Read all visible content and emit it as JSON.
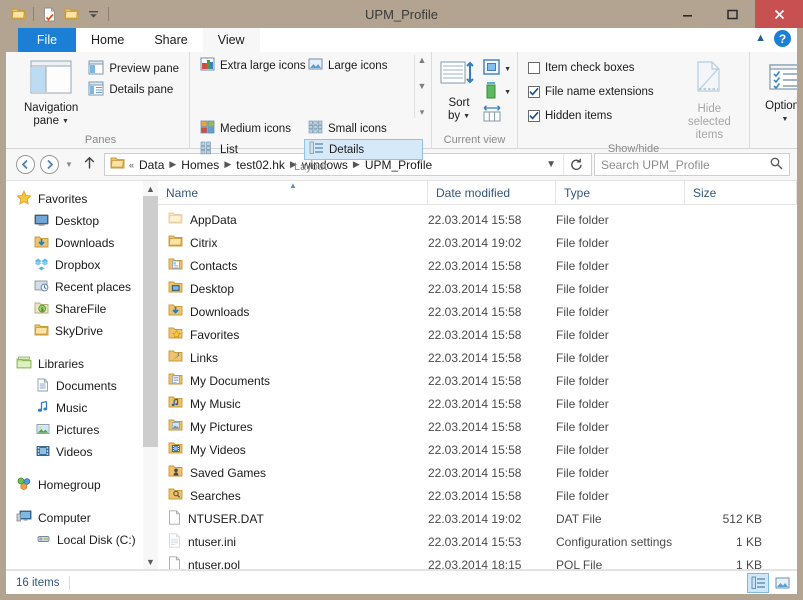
{
  "window": {
    "title": "UPM_Profile",
    "quick_access": [
      {
        "name": "folder-icon",
        "label": "Folder"
      },
      {
        "name": "properties-icon",
        "label": "Properties"
      },
      {
        "name": "new-folder-icon",
        "label": "New folder"
      },
      {
        "name": "customize-dropdown-icon",
        "label": "Customize Quick Access Toolbar"
      }
    ],
    "controls": {
      "minimize": "Minimize",
      "maximize": "Maximize",
      "close": "Close"
    },
    "accent_blue": "#1c7fd6",
    "titlebar_color": "#b3a391",
    "close_color": "#c75050"
  },
  "ribbon": {
    "tabs": [
      {
        "label": "File",
        "active": false,
        "kind": "file"
      },
      {
        "label": "Home",
        "active": false,
        "kind": "normal"
      },
      {
        "label": "Share",
        "active": false,
        "kind": "normal"
      },
      {
        "label": "View",
        "active": true,
        "kind": "normal"
      }
    ],
    "collapse_label": "Minimize the Ribbon",
    "help_label": "?",
    "groups": [
      {
        "name": "panes",
        "label": "Panes",
        "big_button": {
          "label_line1": "Navigation",
          "label_line2": "pane",
          "has_dropdown": true
        },
        "small_buttons": [
          {
            "label": "Preview pane",
            "selected": false
          },
          {
            "label": "Details pane",
            "selected": false
          }
        ]
      },
      {
        "name": "layout",
        "label": "Layout",
        "items": [
          {
            "label": "Extra large icons",
            "selected": false
          },
          {
            "label": "Large icons",
            "selected": false
          },
          {
            "label": "Medium icons",
            "selected": false
          },
          {
            "label": "Small icons",
            "selected": false
          },
          {
            "label": "List",
            "selected": false
          },
          {
            "label": "Details",
            "selected": true
          }
        ]
      },
      {
        "name": "current-view",
        "label": "Current view",
        "sort_by": {
          "label_line1": "Sort",
          "label_line2": "by",
          "has_dropdown": true
        },
        "buttons": [
          {
            "name": "add-columns-button",
            "label": "Add columns"
          },
          {
            "name": "size-all-columns-button",
            "label": "Size all columns to fit"
          }
        ]
      },
      {
        "name": "show-hide",
        "label": "Show/hide",
        "checkboxes": [
          {
            "label": "Item check boxes",
            "checked": false
          },
          {
            "label": "File name extensions",
            "checked": true
          },
          {
            "label": "Hidden items",
            "checked": true
          }
        ],
        "hide_selected": {
          "label_line1": "Hide selected",
          "label_line2": "items",
          "disabled": true
        }
      },
      {
        "name": "options",
        "label": "",
        "options_button": {
          "label": "Options",
          "has_dropdown": true
        }
      }
    ]
  },
  "address_bar": {
    "back_label": "Back",
    "forward_label": "Forward",
    "recent_label": "Recent locations",
    "up_label": "Up",
    "breadcrumbs": [
      "Data",
      "Homes",
      "test02.hk",
      "windows",
      "UPM_Profile"
    ],
    "overflow_marker": "«",
    "dropdown_label": "Previous locations",
    "refresh_label": "Refresh",
    "search": {
      "placeholder": "Search UPM_Profile",
      "value": "",
      "icon": "search-icon"
    }
  },
  "sidebar": {
    "sections": [
      {
        "name": "favorites",
        "label": "Favorites",
        "icon": "star-icon",
        "items": [
          {
            "label": "Desktop",
            "icon": "desktop-icon"
          },
          {
            "label": "Downloads",
            "icon": "downloads-icon"
          },
          {
            "label": "Dropbox",
            "icon": "dropbox-icon"
          },
          {
            "label": "Recent places",
            "icon": "recent-places-icon"
          },
          {
            "label": "ShareFile",
            "icon": "sharefile-icon"
          },
          {
            "label": "SkyDrive",
            "icon": "skydrive-icon"
          }
        ]
      },
      {
        "name": "libraries",
        "label": "Libraries",
        "icon": "libraries-icon",
        "items": [
          {
            "label": "Documents",
            "icon": "documents-icon"
          },
          {
            "label": "Music",
            "icon": "music-icon"
          },
          {
            "label": "Pictures",
            "icon": "pictures-icon"
          },
          {
            "label": "Videos",
            "icon": "videos-icon"
          }
        ]
      },
      {
        "name": "homegroup",
        "label": "Homegroup",
        "icon": "homegroup-icon",
        "items": []
      },
      {
        "name": "computer",
        "label": "Computer",
        "icon": "computer-icon",
        "items": [
          {
            "label": "Local Disk (C:)",
            "icon": "drive-icon"
          }
        ]
      }
    ]
  },
  "file_list": {
    "columns": [
      {
        "key": "name",
        "label": "Name",
        "sorted": "asc"
      },
      {
        "key": "date",
        "label": "Date modified",
        "sorted": null
      },
      {
        "key": "type",
        "label": "Type",
        "sorted": null
      },
      {
        "key": "size",
        "label": "Size",
        "sorted": null
      }
    ],
    "rows": [
      {
        "name": "AppData",
        "date": "22.03.2014 15:58",
        "type": "File folder",
        "size": "",
        "icon": "folder-icon",
        "hidden": true
      },
      {
        "name": "Citrix",
        "date": "22.03.2014 19:02",
        "type": "File folder",
        "size": "",
        "icon": "folder-icon",
        "hidden": false
      },
      {
        "name": "Contacts",
        "date": "22.03.2014 15:58",
        "type": "File folder",
        "size": "",
        "icon": "contacts-folder-icon",
        "hidden": false
      },
      {
        "name": "Desktop",
        "date": "22.03.2014 15:58",
        "type": "File folder",
        "size": "",
        "icon": "desktop-folder-icon",
        "hidden": false
      },
      {
        "name": "Downloads",
        "date": "22.03.2014 15:58",
        "type": "File folder",
        "size": "",
        "icon": "downloads-folder-icon",
        "hidden": false
      },
      {
        "name": "Favorites",
        "date": "22.03.2014 15:58",
        "type": "File folder",
        "size": "",
        "icon": "favorites-folder-icon",
        "hidden": false
      },
      {
        "name": "Links",
        "date": "22.03.2014 15:58",
        "type": "File folder",
        "size": "",
        "icon": "links-folder-icon",
        "hidden": false
      },
      {
        "name": "My Documents",
        "date": "22.03.2014 15:58",
        "type": "File folder",
        "size": "",
        "icon": "documents-folder-icon",
        "hidden": false
      },
      {
        "name": "My Music",
        "date": "22.03.2014 15:58",
        "type": "File folder",
        "size": "",
        "icon": "music-folder-icon",
        "hidden": false
      },
      {
        "name": "My Pictures",
        "date": "22.03.2014 15:58",
        "type": "File folder",
        "size": "",
        "icon": "pictures-folder-icon",
        "hidden": false
      },
      {
        "name": "My Videos",
        "date": "22.03.2014 15:58",
        "type": "File folder",
        "size": "",
        "icon": "videos-folder-icon",
        "hidden": false
      },
      {
        "name": "Saved Games",
        "date": "22.03.2014 15:58",
        "type": "File folder",
        "size": "",
        "icon": "saved-games-folder-icon",
        "hidden": false
      },
      {
        "name": "Searches",
        "date": "22.03.2014 15:58",
        "type": "File folder",
        "size": "",
        "icon": "searches-folder-icon",
        "hidden": false
      },
      {
        "name": "NTUSER.DAT",
        "date": "22.03.2014 19:02",
        "type": "DAT File",
        "size": "512 KB",
        "icon": "blank-file-icon",
        "hidden": false
      },
      {
        "name": "ntuser.ini",
        "date": "22.03.2014 15:53",
        "type": "Configuration settings",
        "size": "1 KB",
        "icon": "ini-file-icon",
        "hidden": true
      },
      {
        "name": "ntuser.pol",
        "date": "22.03.2014 18:15",
        "type": "POL File",
        "size": "1 KB",
        "icon": "blank-file-icon",
        "hidden": false
      }
    ]
  },
  "status_bar": {
    "item_count": "16 items",
    "views": [
      {
        "name": "details-view-button",
        "label": "Details view",
        "active": true
      },
      {
        "name": "large-icons-view-button",
        "label": "Large icons view",
        "active": false
      }
    ]
  }
}
